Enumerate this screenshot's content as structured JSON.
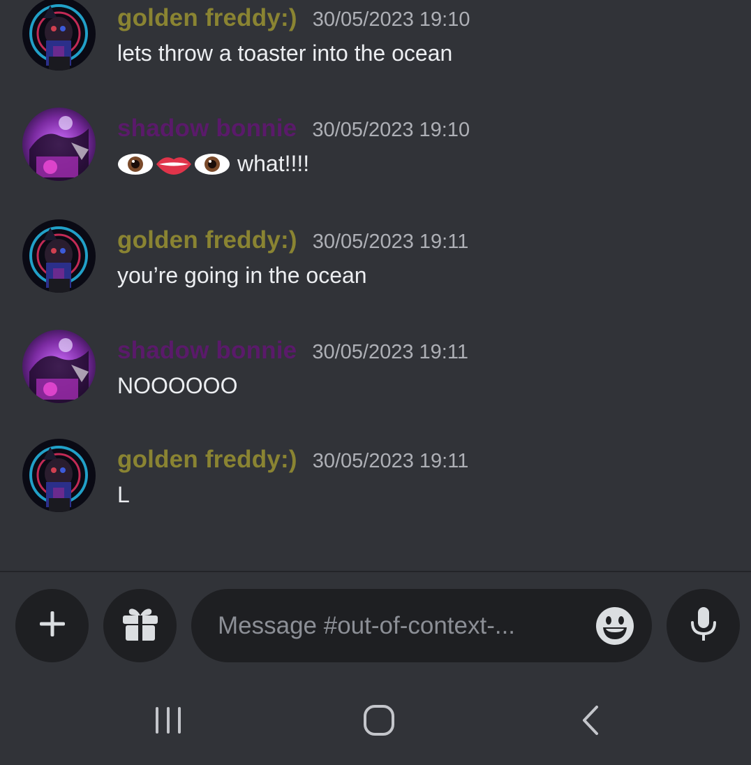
{
  "colors": {
    "background": "#313338",
    "golden_freddy_name": "#8a8432",
    "shadow_bonnie_name": "#5a1a6a",
    "timestamp": "#aeb0b6",
    "input_bg": "#1e1f22"
  },
  "messages": [
    {
      "username": "golden freddy:)",
      "timestamp": "30/05/2023 19:10",
      "text": "lets throw a toaster into the ocean",
      "avatar": "golden-freddy-avatar"
    },
    {
      "username": "shadow bonnie",
      "timestamp": "30/05/2023 19:10",
      "text": "what!!!!",
      "emojis": [
        "eye",
        "mouth",
        "eye"
      ],
      "avatar": "shadow-bonnie-avatar"
    },
    {
      "username": "golden freddy:)",
      "timestamp": "30/05/2023 19:11",
      "text": "you’re going in the ocean",
      "avatar": "golden-freddy-avatar"
    },
    {
      "username": "shadow bonnie",
      "timestamp": "30/05/2023 19:11",
      "text": "NOOOOOO",
      "avatar": "shadow-bonnie-avatar"
    },
    {
      "username": "golden freddy:)",
      "timestamp": "30/05/2023 19:11",
      "text": "L",
      "avatar": "golden-freddy-avatar"
    }
  ],
  "composer": {
    "add_icon": "plus-icon",
    "gift_icon": "gift-icon",
    "placeholder": "Message #out-of-context-...",
    "emoji_icon": "smile-icon",
    "mic_icon": "microphone-icon"
  },
  "navbar": {
    "recents_icon": "recent-apps-icon",
    "home_icon": "home-icon",
    "back_icon": "back-icon"
  }
}
